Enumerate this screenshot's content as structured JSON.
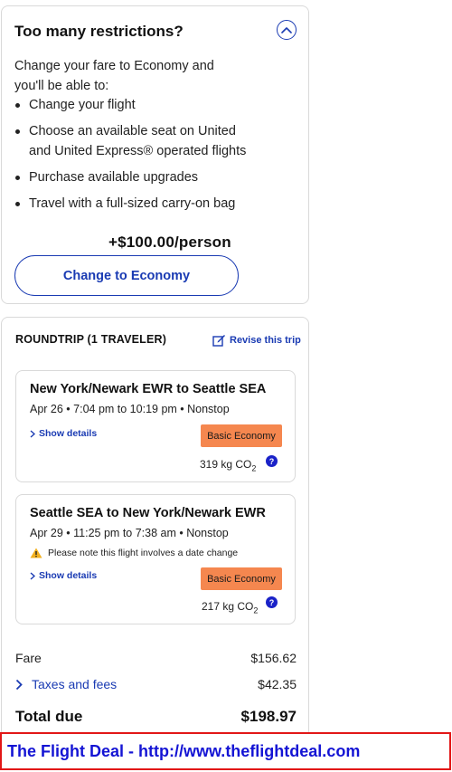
{
  "restrictions": {
    "title": "Too many restrictions?",
    "collapse_icon": "chevron-up-circle-icon",
    "intro": "Change your fare to Economy and you'll be able to:",
    "benefits": [
      "Change your flight",
      "Choose an available seat on United and United Express® operated flights",
      "Purchase available upgrades",
      "Travel with a full-sized carry-on bag"
    ],
    "price": "+$100.00/person",
    "button_label": "Change to Economy"
  },
  "trip": {
    "label": "ROUNDTRIP (1 TRAVELER)",
    "revise_label": "Revise this trip",
    "revise_icon": "edit-icon",
    "flights": [
      {
        "route": "New York/Newark EWR to Seattle SEA",
        "times": "Apr 26 • 7:04 pm to 10:19 pm • Nonstop",
        "show_details": "Show details",
        "fare_class": "Basic Economy",
        "co2_value": "319 kg CO",
        "co2_sub": "2"
      },
      {
        "route": "Seattle SEA to New York/Newark EWR",
        "times": "Apr 29 • 11:25 pm to 7:38 am • Nonstop",
        "note": "Please note this flight involves a date change",
        "show_details": "Show details",
        "fare_class": "Basic Economy",
        "co2_value": "217 kg CO",
        "co2_sub": "2"
      }
    ],
    "summary": {
      "fare_label": "Fare",
      "fare_value": "$156.62",
      "taxes_label": "Taxes and fees",
      "taxes_value": "$42.35",
      "total_label": "Total due",
      "total_value": "$198.97"
    }
  },
  "banner": {
    "text": "The Flight Deal - http://www.theflightdeal.com"
  },
  "colors": {
    "accent": "#1a3bb3",
    "badge": "#f5874f",
    "banner_border": "#e21717",
    "banner_text": "#1414d4"
  }
}
